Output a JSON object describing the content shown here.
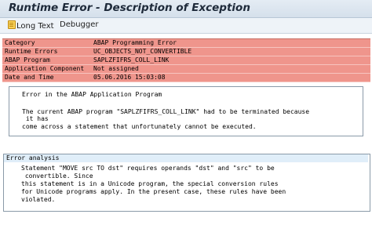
{
  "window": {
    "title": "Runtime Error - Description of Exception"
  },
  "toolbar": {
    "long_text": "Long Text",
    "debugger": "Debugger"
  },
  "info": [
    {
      "key": "Category",
      "value": "ABAP Programming Error"
    },
    {
      "key": "Runtime Errors",
      "value": "UC_OBJECTS_NOT_CONVERTIBLE"
    },
    {
      "key": "ABAP Program",
      "value": "SAPLZFIFRS_COLL_LINK"
    },
    {
      "key": "Application Component",
      "value": "Not assigned"
    },
    {
      "key": "Date and Time",
      "value": "05.06.2016 15:03:08"
    }
  ],
  "error_box": {
    "heading": "Error in the ABAP Application Program",
    "lines": [
      "The current ABAP program \"SAPLZFIFRS_COLL_LINK\" had to be terminated because",
      " it has",
      "come across a statement that unfortunately cannot be executed."
    ]
  },
  "analysis_box": {
    "heading": "Error analysis",
    "lines": [
      "Statement \"MOVE src TO dst\" requires operands \"dst\" and \"src\" to be",
      " convertible. Since",
      "this statement is in a Unicode program, the special conversion rules",
      "for Unicode programs apply. In the present case, these rules have been",
      "violated."
    ]
  },
  "colors": {
    "info_bg": "#ef958c",
    "titlebar": "#dbe5ef",
    "analysis_heading_bg": "#e0eef9"
  }
}
